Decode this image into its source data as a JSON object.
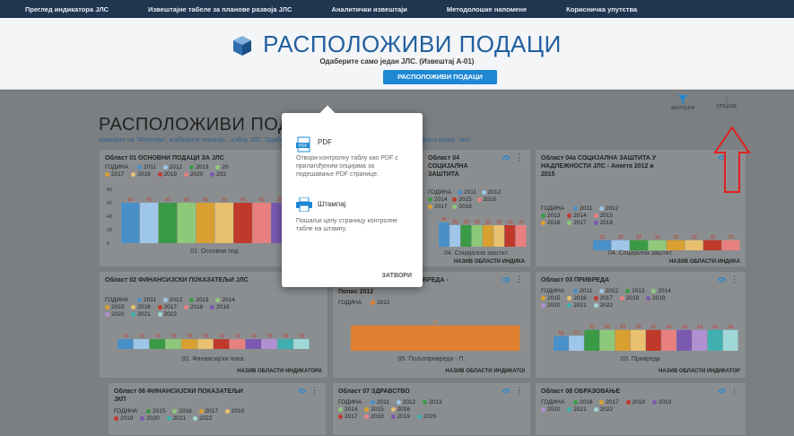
{
  "nav": {
    "items": [
      "Преглед индикатора ЈЛС",
      "Извештајне табеле за планове развоја ЈЛС",
      "Аналитички извештаји",
      "Методолошке напомене",
      "Корисничка упутства"
    ]
  },
  "hero": {
    "title": "РАСПОЛОЖИВИ ПОДАЦИ",
    "subtitle": "Одаберите само један ЈЛС. (Извештај А-01)",
    "button": "РАСПОЛОЖИВИ ПОДАЦИ"
  },
  "section": {
    "title": "РАСПОЛОЖИВИ ПОДА",
    "desc": "Кликните на \"Филтери\", изаберите територ... избор ЈЛС. Одаберите само један ЈЛС. На жељеној области одабрати икону \"око\".",
    "filters": "ФИЛТЕРИ",
    "options": "ОПЦИЈЕ"
  },
  "popup": {
    "pdf_title": "PDF",
    "pdf_desc": "Отвори контролну таблу као PDF с прилагођеним опцијама за подешавање PDF странице.",
    "print_title": "Штампај",
    "print_desc": "Пошаљи целу страницу контролне табле на штампу.",
    "close": "ЗАТВОРИ"
  },
  "colors": {
    "accent": "#1e88d4",
    "nav": "#1f3550",
    "red": "#e02020"
  },
  "cards": [
    {
      "title": "Област 01 ОСНОВНИ ПОДАЦИ ЗА ЈЛС",
      "legend": [
        "ГОДИНА",
        "2011",
        "2012",
        "2013",
        "20",
        "2017",
        "2018",
        "2019",
        "2020",
        "202"
      ],
      "caption": "01. Основни под",
      "foot": ""
    },
    {
      "title": "Област 04 СОЦИЈАЛНА ЗАШТИТА",
      "legend": [
        "ГОДИНА",
        "2011",
        "2012",
        "2014",
        "2015",
        "2016",
        "2017",
        "2018"
      ],
      "caption": "04. Социјална заштит.",
      "foot": "НАЗИВ ОБЛАСТИ ИНДИКА"
    },
    {
      "title": "Област 04а СОЦИЈАЛНА ЗАШТИТА У НАДЛЕЖНОСТИ ЈЛС - Анкета 2012 и 2015",
      "legend": [
        "ГОДИНА",
        "2011",
        "2012",
        "2013",
        "2014",
        "2015",
        "2016",
        "2017",
        "2018"
      ],
      "caption": "04. Социјална заштит.",
      "foot": "НАЗИВ ОБЛАСТИ ИНДИКА"
    },
    {
      "title": "Област 02 ФИНАНСИЈСКИ ПОКАЗАТЕЉИ ЈЛС",
      "legend": [
        "ГОДИНА",
        "2011",
        "2012",
        "2013",
        "2014",
        "2015",
        "2016",
        "2017",
        "2018",
        "2019",
        "2020",
        "2021",
        "2022"
      ],
      "caption": "02. Финансијски пока.",
      "foot": "НАЗИВ ОБЛАСТИ ИНДИКАТОРА"
    },
    {
      "title": "Попис 2012",
      "legend": [
        "ГОДИНА",
        "2012"
      ],
      "caption": "05. Пољопривреда - П.",
      "foot": "НАЗИВ ОБЛАСТИ ИНДИКАТОІ",
      "title2": "ВРЕДА -"
    },
    {
      "title": "Област 03 ПРИВРЕДА",
      "legend": [
        "ГОДИНА",
        "2011",
        "2012",
        "2013",
        "2014",
        "2015",
        "2016",
        "2017",
        "2018",
        "2019",
        "2020",
        "2021",
        "2022"
      ],
      "caption": "03. Привреда",
      "foot": "НАЗИВ ОБЛАСТИ ИНДИКАТОР"
    },
    {
      "title": "Област 06 ФИНАНСИЈСКИ ПОКАЗАТЕЉИ ЈКП",
      "legend": [
        "ГОДИНА",
        "2015",
        "2016",
        "2017",
        "2018",
        "2019",
        "2020",
        "2021",
        "2022"
      ],
      "caption": "",
      "foot": ""
    },
    {
      "title": "Област 07 ЗДРАВСТВО",
      "legend": [
        "ГОДИНА",
        "2011",
        "2012",
        "2013",
        "2014",
        "2015",
        "2016",
        "2017",
        "2018",
        "2019",
        "2020",
        "2021"
      ],
      "caption": "",
      "foot": ""
    },
    {
      "title": "Област 08 ОБРАЗОВАЊЕ",
      "legend": [
        "ГОДИНА",
        "2016",
        "2017",
        "2018",
        "2019",
        "2020",
        "2021",
        "2022"
      ],
      "caption": "",
      "foot": ""
    }
  ],
  "chart_data": [
    {
      "type": "bar",
      "categories": [
        "2011",
        "2012",
        "2013",
        "2014",
        "2015",
        "2016",
        "2017",
        "2018",
        "2019",
        "2020",
        "2021"
      ],
      "values": [
        60,
        60,
        60,
        60,
        60,
        60,
        60,
        60,
        60,
        60,
        60
      ],
      "ylim": [
        0,
        80
      ],
      "yticks": [
        "80",
        "60",
        "40",
        "20",
        "0"
      ]
    },
    {
      "type": "bar",
      "categories": [
        "2011",
        "2012",
        "2013",
        "2014",
        "2015",
        "2016",
        "2017",
        "2018"
      ],
      "values": [
        36,
        32,
        32,
        32,
        32,
        32,
        32,
        32
      ],
      "ylim": [
        0,
        40
      ]
    },
    {
      "type": "bar",
      "categories": [
        "2011",
        "2012",
        "2013",
        "2014",
        "2015",
        "2016",
        "2017",
        "2018"
      ],
      "values": [
        32,
        32,
        32,
        32,
        32,
        32,
        32,
        32
      ],
      "ylim": [
        0,
        40
      ]
    },
    {
      "type": "bar",
      "categories": [
        "2011",
        "2012",
        "2013",
        "2014",
        "2015",
        "2016",
        "2017",
        "2018",
        "2019",
        "2020",
        "2021",
        "2022"
      ],
      "values": [
        73,
        73,
        73,
        73,
        73,
        73,
        73,
        73,
        73,
        73,
        73,
        73
      ],
      "ylim": [
        0,
        120
      ]
    },
    {
      "type": "bar",
      "categories": [
        "2012"
      ],
      "values": [
        47
      ],
      "ylim": [
        0,
        60
      ]
    },
    {
      "type": "bar",
      "categories": [
        "2011",
        "2012",
        "2013",
        "2014",
        "2015",
        "2016",
        "2017",
        "2018",
        "2019",
        "2020",
        "2021",
        "2022"
      ],
      "values": [
        65,
        67,
        93,
        93,
        93,
        93,
        93,
        93,
        93,
        93,
        93,
        93
      ],
      "ylim": [
        0,
        120
      ]
    }
  ]
}
